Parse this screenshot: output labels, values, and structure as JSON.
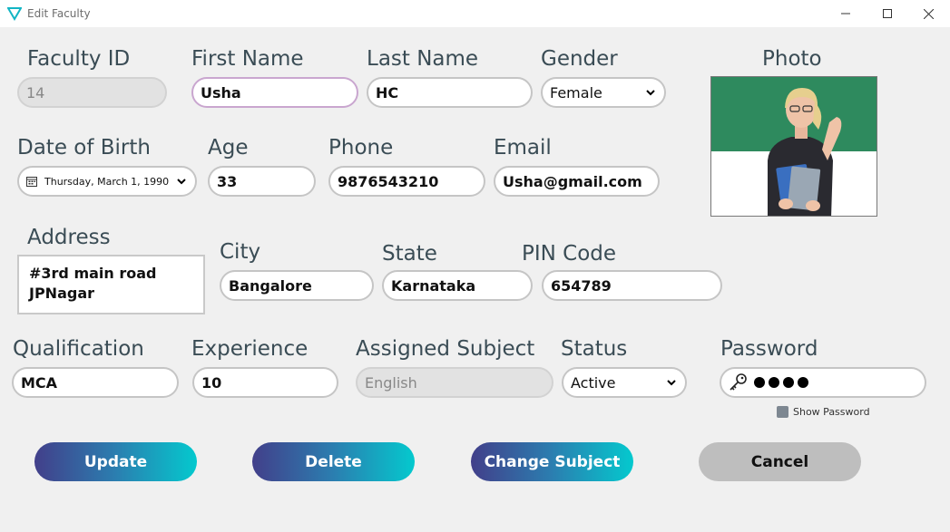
{
  "window": {
    "title": "Edit Faculty"
  },
  "labels": {
    "faculty_id": "Faculty ID",
    "first_name": "First Name",
    "last_name": "Last Name",
    "gender": "Gender",
    "photo": "Photo",
    "dob": "Date of Birth",
    "age": "Age",
    "phone": "Phone",
    "email": "Email",
    "address": "Address",
    "city": "City",
    "state": "State",
    "pin": "PIN Code",
    "qualification": "Qualification",
    "experience": "Experience",
    "assigned_subject": "Assigned Subject",
    "status": "Status",
    "password": "Password",
    "show_password": "Show Password"
  },
  "values": {
    "faculty_id": "14",
    "first_name": "Usha",
    "last_name": "HC",
    "gender": "Female",
    "dob": "Thursday, March 1, 1990",
    "age": "33",
    "phone": "9876543210",
    "email": "Usha@gmail.com",
    "address_line1": "#3rd main road",
    "address_line2": "JPNagar",
    "city": "Bangalore",
    "state": "Karnataka",
    "pin": "654789",
    "qualification": "MCA",
    "experience": "10",
    "assigned_subject": "English",
    "status": "Active"
  },
  "buttons": {
    "update": "Update",
    "delete": "Delete",
    "change_subject": "Change Subject",
    "cancel": "Cancel"
  },
  "icons": {
    "app": "triangle-logo-icon",
    "calendar": "calendar-icon",
    "key": "key-icon",
    "dropdown": "chevron-down-icon"
  },
  "colors": {
    "label": "#3a4c55",
    "gradient_start": "#423f8a",
    "gradient_end": "#04c9ce",
    "cancel": "#bebebe"
  }
}
